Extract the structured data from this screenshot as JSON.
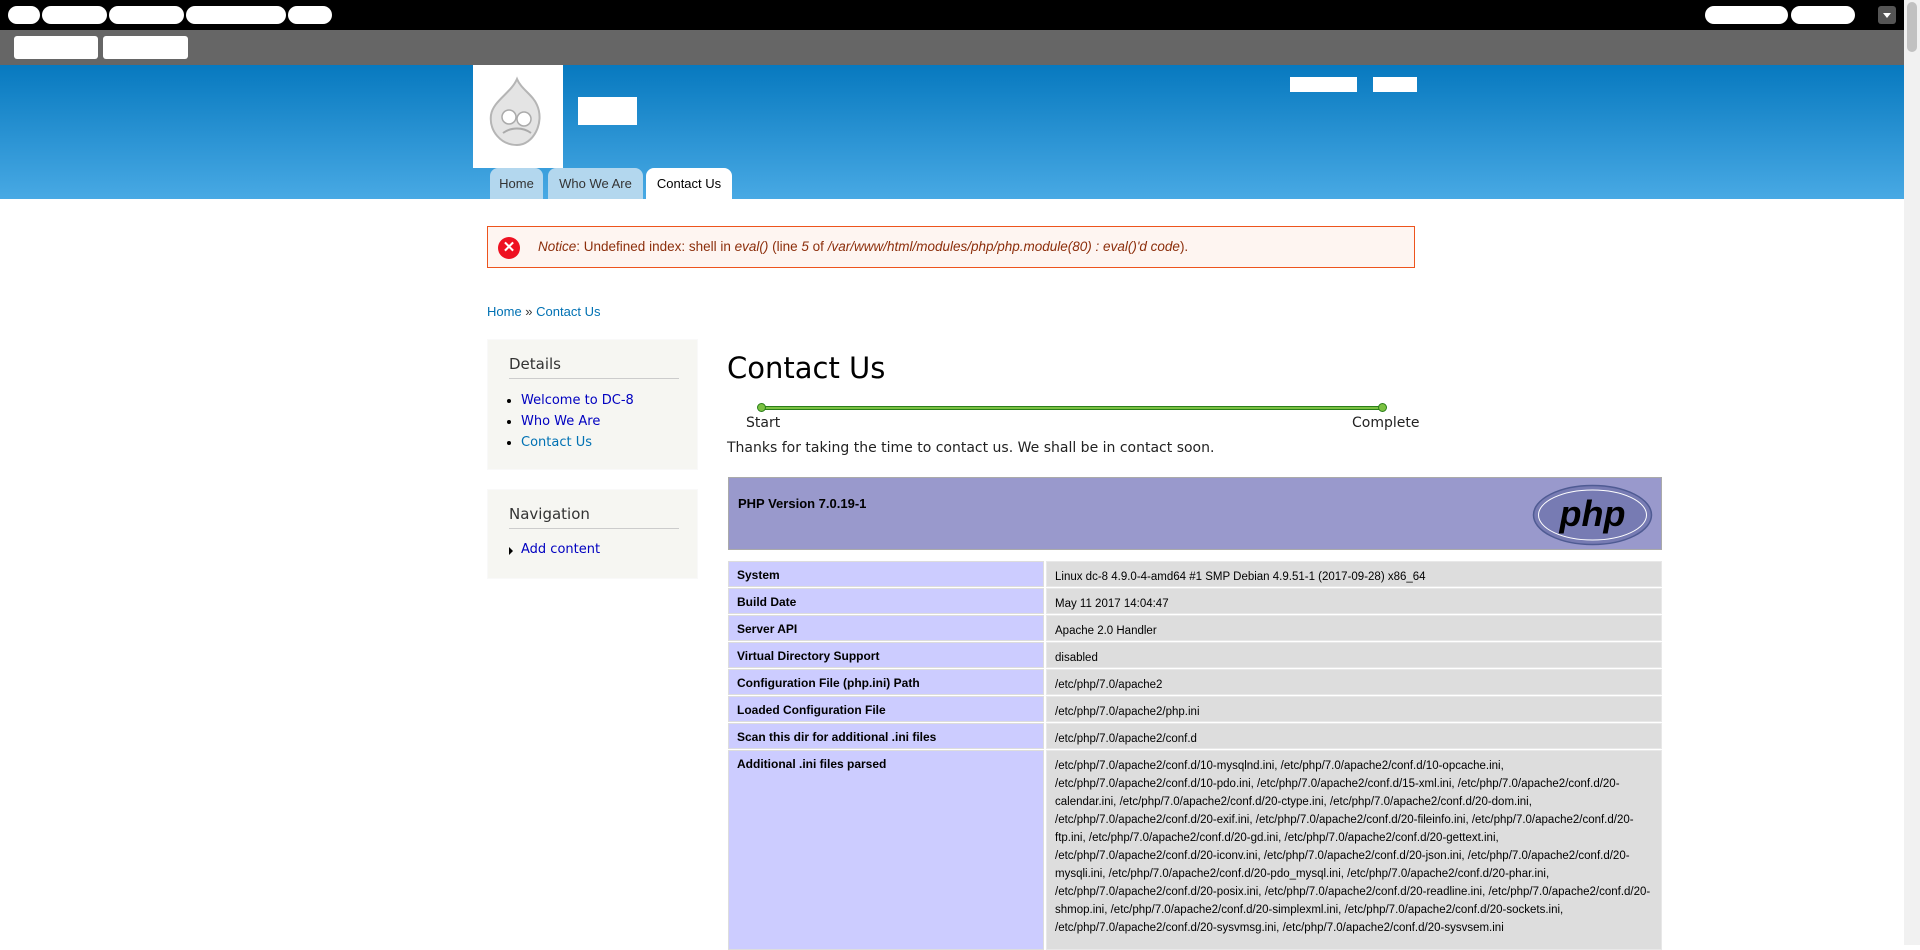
{
  "tabs": [
    "Home",
    "Who We Are",
    "Contact Us"
  ],
  "message": {
    "label": "Notice",
    "text1": ": Undefined index: shell in ",
    "func": "eval()",
    "text2": " (line ",
    "line": "5",
    "text3": " of ",
    "path": "/var/www/html/modules/php/php.module(80) : eval()'d code",
    "text4": ")."
  },
  "breadcrumb": {
    "home": "Home",
    "sep": " » ",
    "current": "Contact Us"
  },
  "sidebar": {
    "details_title": "Details",
    "details_items": [
      "Welcome to DC-8",
      "Who We Are",
      "Contact Us"
    ],
    "nav_title": "Navigation",
    "nav_item": "Add content"
  },
  "page": {
    "title": "Contact Us",
    "steps": [
      "Start",
      "Complete"
    ],
    "thanks": "Thanks for taking the time to contact us. We shall be in contact soon."
  },
  "phpinfo": {
    "version": "PHP Version 7.0.19-1",
    "logo_text": "php",
    "rows": [
      {
        "k": "System",
        "v": "Linux dc-8 4.9.0-4-amd64 #1 SMP Debian 4.9.51-1 (2017-09-28) x86_64"
      },
      {
        "k": "Build Date",
        "v": "May 11 2017 14:04:47"
      },
      {
        "k": "Server API",
        "v": "Apache 2.0 Handler"
      },
      {
        "k": "Virtual Directory Support",
        "v": "disabled"
      },
      {
        "k": "Configuration File (php.ini) Path",
        "v": "/etc/php/7.0/apache2"
      },
      {
        "k": "Loaded Configuration File",
        "v": "/etc/php/7.0/apache2/php.ini"
      },
      {
        "k": "Scan this dir for additional .ini files",
        "v": "/etc/php/7.0/apache2/conf.d"
      },
      {
        "k": "Additional .ini files parsed",
        "v": "/etc/php/7.0/apache2/conf.d/10-mysqlnd.ini, /etc/php/7.0/apache2/conf.d/10-opcache.ini, /etc/php/7.0/apache2/conf.d/10-pdo.ini, /etc/php/7.0/apache2/conf.d/15-xml.ini, /etc/php/7.0/apache2/conf.d/20-calendar.ini, /etc/php/7.0/apache2/conf.d/20-ctype.ini, /etc/php/7.0/apache2/conf.d/20-dom.ini, /etc/php/7.0/apache2/conf.d/20-exif.ini, /etc/php/7.0/apache2/conf.d/20-fileinfo.ini, /etc/php/7.0/apache2/conf.d/20-ftp.ini, /etc/php/7.0/apache2/conf.d/20-gd.ini, /etc/php/7.0/apache2/conf.d/20-gettext.ini, /etc/php/7.0/apache2/conf.d/20-iconv.ini, /etc/php/7.0/apache2/conf.d/20-json.ini, /etc/php/7.0/apache2/conf.d/20-mysqli.ini, /etc/php/7.0/apache2/conf.d/20-pdo_mysql.ini, /etc/php/7.0/apache2/conf.d/20-phar.ini, /etc/php/7.0/apache2/conf.d/20-posix.ini, /etc/php/7.0/apache2/conf.d/20-readline.ini, /etc/php/7.0/apache2/conf.d/20-shmop.ini, /etc/php/7.0/apache2/conf.d/20-simplexml.ini, /etc/php/7.0/apache2/conf.d/20-sockets.ini, /etc/php/7.0/apache2/conf.d/20-sysvmsg.ini, /etc/php/7.0/apache2/conf.d/20-sysvsem.ini"
      }
    ]
  }
}
